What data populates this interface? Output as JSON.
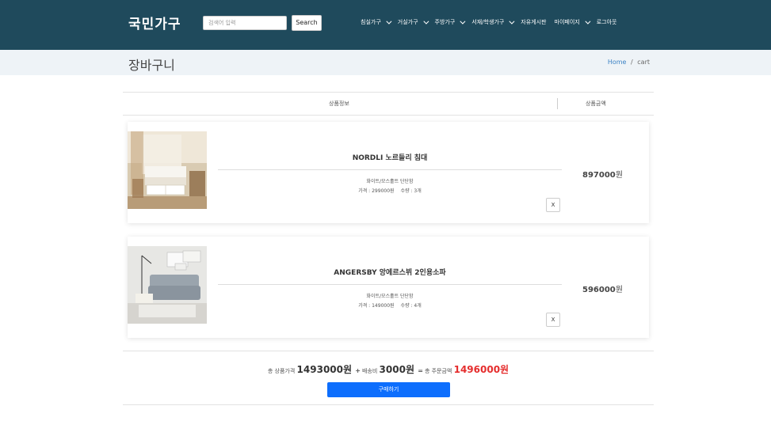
{
  "header": {
    "brand": "국민가구",
    "search_placeholder": "검색어 입력",
    "search_label": "Search",
    "nav": [
      {
        "label": "침실가구",
        "dropdown": true
      },
      {
        "label": "거실가구",
        "dropdown": true
      },
      {
        "label": "주방가구",
        "dropdown": true
      },
      {
        "label": "서재/학생가구",
        "dropdown": true
      },
      {
        "label": "자유게시판",
        "dropdown": false
      },
      {
        "label": "마이페이지",
        "dropdown": true
      },
      {
        "label": "로그아웃",
        "dropdown": false
      }
    ]
  },
  "titlebar": {
    "title": "장바구니",
    "breadcrumb_home": "Home",
    "breadcrumb_sep": "/",
    "breadcrumb_current": "cart"
  },
  "cart": {
    "col_info": "상품정보",
    "col_price": "상품금액",
    "items": [
      {
        "name": "NORDLI 노르들리 침대",
        "option": "화이트/모스홀트 단단함",
        "price": "가격 : 299000원",
        "qty": "수량 : 3개",
        "remove": "X",
        "total": "897000",
        "won": "원"
      },
      {
        "name": "ANGERSBY 앙에르스뷔 2인용소파",
        "option": "화이트/모스홀트 단단함",
        "price": "가격 : 149000원",
        "qty": "수량 : 4개",
        "remove": "X",
        "total": "596000",
        "won": "원"
      }
    ]
  },
  "summary": {
    "subtotal_label": "총 상품가격",
    "subtotal": "1493000원",
    "plus": "+",
    "shipping_label": "배송비",
    "shipping": "3000원",
    "equals": "=",
    "grand_label": "총 주문금액",
    "grand": "1496000원",
    "buy_label": "구매하기"
  },
  "colors": {
    "navbar": "#1f4a5c",
    "titlebar": "#eef3f7",
    "buy_button": "#0d6efd",
    "grand_total": "#e52d2d"
  }
}
